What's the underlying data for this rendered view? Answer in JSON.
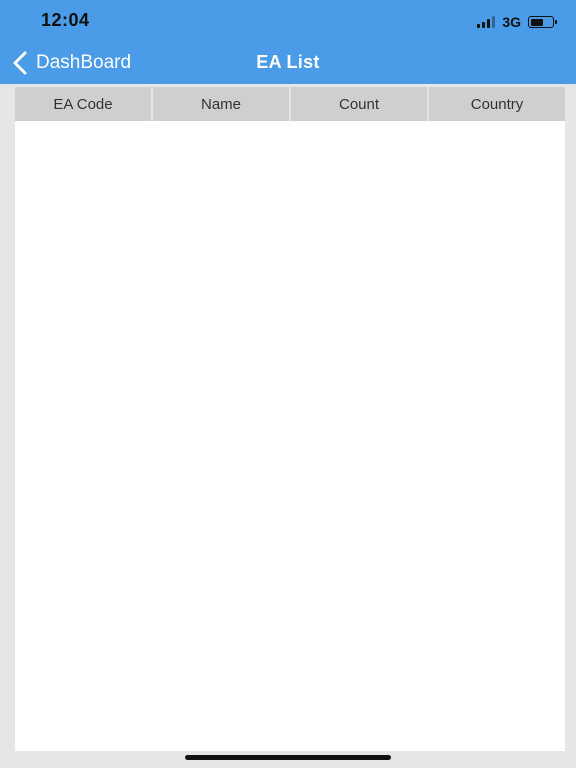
{
  "status_bar": {
    "time": "12:04",
    "network": "3G",
    "signal_bars_filled": 3,
    "signal_bars_total": 4,
    "battery_level_percent": 60
  },
  "nav": {
    "back_label": "DashBoard",
    "title": "EA List",
    "bar_color": "#4a9be8"
  },
  "table": {
    "columns": [
      "EA Code",
      "Name",
      "Count",
      "Country"
    ],
    "rows": []
  },
  "icons": {
    "back": "chevron-left-icon",
    "signal": "cellular-signal-icon",
    "battery": "battery-icon"
  }
}
